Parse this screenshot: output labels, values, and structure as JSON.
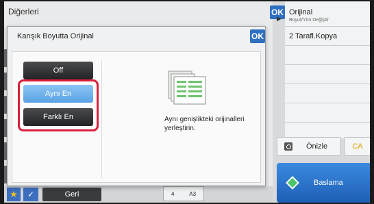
{
  "background": {
    "title": "Diğerleri",
    "ok_label": "OK"
  },
  "right_panel": {
    "original_label": "Orijinal",
    "original_sub": "Boyut/Yön Değiştir",
    "copy_label": "2 Tarafl.Kopya",
    "preview_label": "Önizle",
    "ca_label": "CA",
    "start_label": "Baslama"
  },
  "dialog": {
    "title": "Karışık Boyutta Orijinal",
    "ok_label": "OK",
    "options": [
      "Off",
      "Aynı En",
      "Farklı En"
    ],
    "selected": "Aynı En",
    "description": "Aynı genişlikteki orijinalleri yerleştirin."
  },
  "bottom_bar": {
    "back_label": "Geri",
    "counter_left": "4",
    "counter_paper": "A3"
  },
  "colors": {
    "accent": "#2f6fc0",
    "highlight": "#d8203a",
    "selected": "#5aa2e4"
  }
}
